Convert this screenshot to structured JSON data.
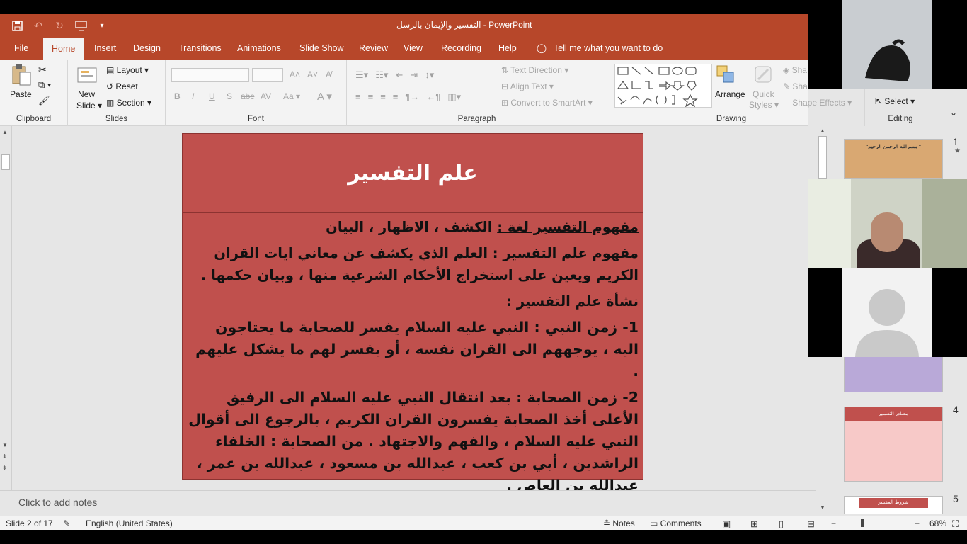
{
  "window": {
    "title": "التفسير والإيمان بالرسل  -  PowerPoint"
  },
  "qat": {
    "save_icon": "save-icon",
    "undo_icon": "undo-icon",
    "redo_icon": "redo-icon",
    "present_icon": "present-from-start-icon",
    "customize_icon": "customize-qat-icon"
  },
  "tabs": [
    {
      "label": "File"
    },
    {
      "label": "Home"
    },
    {
      "label": "Insert"
    },
    {
      "label": "Design"
    },
    {
      "label": "Transitions"
    },
    {
      "label": "Animations"
    },
    {
      "label": "Slide Show"
    },
    {
      "label": "Review"
    },
    {
      "label": "View"
    },
    {
      "label": "Recording"
    },
    {
      "label": "Help"
    }
  ],
  "tell_me": "Tell me what you want to do",
  "ribbon": {
    "clipboard": {
      "paste": "Paste",
      "label": "Clipboard"
    },
    "slides": {
      "new_slide": "New",
      "new_slide2": "Slide",
      "layout": "Layout",
      "reset": "Reset",
      "section": "Section",
      "label": "Slides"
    },
    "font": {
      "label": "Font",
      "bold": "B",
      "italic": "I",
      "underline": "U",
      "shadow": "S",
      "strike": "abc",
      "case": "Aa",
      "color": "A"
    },
    "paragraph": {
      "label": "Paragraph",
      "text_direction": "Text Direction",
      "align_text": "Align Text",
      "smartart": "Convert to SmartArt"
    },
    "drawing": {
      "label": "Drawing",
      "arrange": "Arrange",
      "quick_styles": "Quick",
      "quick_styles2": "Styles",
      "shape_effects": "Shape Effects",
      "shape_fill": "Sha",
      "shape_outline": "Sha"
    },
    "editing": {
      "label": "Editing",
      "select": "Select"
    }
  },
  "slide": {
    "title": "علم التفسير",
    "lines": [
      {
        "u": "مفهوم التفسير لغة :",
        "t": " الكشف ، الاظهار ، البيان"
      },
      {
        "u": "مفهوم علم التفسير",
        "t": " : العلم الذي يكشف عن معاني ايات القران الكريم ويعين على استخراج الأحكام الشرعية منها ، وبيان حكمها ."
      },
      {
        "u": "نشأة علم التفسير :",
        "t": ""
      },
      {
        "u": "",
        "t": "1- زمن النبي :  النبي عليه السلام يفسر للصحابة ما يحتاجون اليه ، يوجههم الى القران نفسه ، أو يفسر لهم ما يشكل عليهم ."
      },
      {
        "u": "",
        "t": "2- زمن الصحابة : بعد انتقال النبي عليه السلام الى الرفيق الأعلى أخذ الصحابة يفسرون القران الكريم ، بالرجوع الى أقوال النبي عليه السلام ، والفهم والاجتهاد . من الصحابة : الخلفاء الراشدين ، أبي بن كعب ، عبدالله بن مسعود ، عبدالله بن عمر ، عبدالله بن العاص ."
      }
    ]
  },
  "notes_placeholder": "Click to add notes",
  "thumbnails": [
    {
      "num": "1",
      "text": "\"بسم الله الرحمن الرحيم \"",
      "color": "#d9a872"
    },
    {
      "num": "4",
      "text": "مصادر التفسير",
      "color": "#c0504d"
    },
    {
      "num": "5",
      "text": "شروط المفسر",
      "color": "#c0504d"
    }
  ],
  "status": {
    "slide_info": "Slide 2 of 17",
    "language": "English (United States)",
    "notes": "Notes",
    "comments": "Comments",
    "zoom": "68%",
    "zoom_minus": "−",
    "zoom_plus": "+"
  },
  "colors": {
    "accent": "#b7472a",
    "slide_fill": "#c0504d"
  }
}
